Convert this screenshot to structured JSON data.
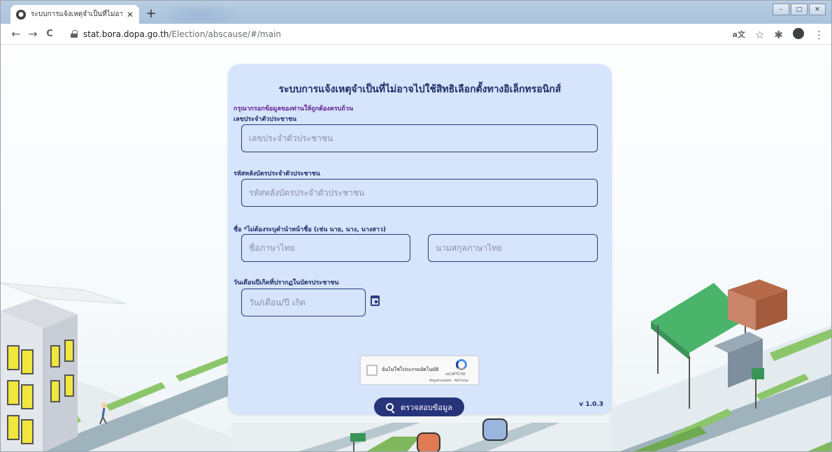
{
  "browser": {
    "tab_title": "ระบบการแจ้งเหตุจำเป็นที่ไม่อาจไปใช้สิท",
    "url_host": "stat.bora.dopa.go.th",
    "url_path": "/Election/abscause/#/main",
    "nav": {
      "back": "←",
      "forward": "→",
      "reload": "C"
    },
    "toolbar_icons": [
      "translate-icon",
      "star-icon",
      "extensions-icon",
      "profile-icon",
      "menu-icon"
    ]
  },
  "form": {
    "title": "ระบบการแจ้งเหตุจำเป็นที่ไม่อาจไปใช้สิทธิเลือกตั้งทางอิเล็กทรอนิกส์",
    "hint": "กรุณากรอกข้อมูลของท่านให้ถูกต้องครบถ้วน",
    "id_label": "เลขประจำตัวประชาชน",
    "id_placeholder": "เลขประจำตัวประชาชน",
    "laser_label": "รหัสหลังบัตรประจำตัวประชาชน",
    "laser_placeholder": "รหัสหลังบัตรประจำตัวประชาชน",
    "name_label": "ชื่อ *ไม่ต้องระบุคำนำหน้าชื่อ (เช่น นาย, นาง, นางสาว)",
    "firstname_placeholder": "ชื่อภาษาไทย",
    "lastname_placeholder": "นามสกุลภาษาไทย",
    "dob_label": "วันเดือนปีเกิดที่ปรากฏในบัตรประชาชน",
    "dob_placeholder": "วัน/เดือน/ปี เกิด",
    "captcha_label": "ฉันไม่ใช่โปรแกรมอัตโนมัติ",
    "captcha_brand": "reCAPTCHA",
    "captcha_terms": "ข้อมูลส่วนบุคคล - ข้อกำหนด",
    "submit_label": "ตรวจสอบข้อมูล",
    "version": "v 1.0.3"
  },
  "colors": {
    "card_bg": "#d6e4fc",
    "primary": "#27347a",
    "title": "#1f2c66",
    "hint": "#5e1f8c"
  }
}
